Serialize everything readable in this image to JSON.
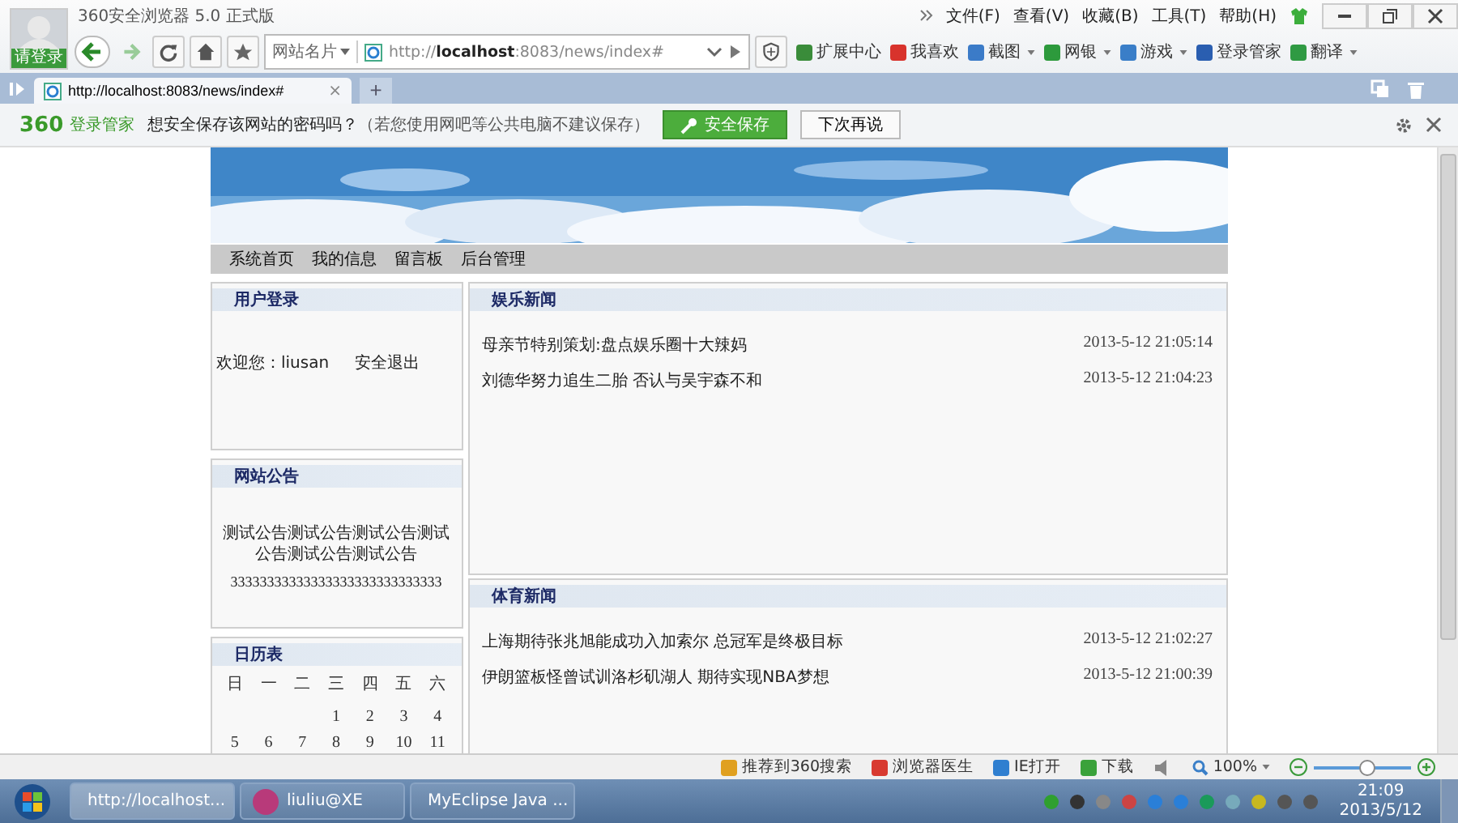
{
  "browser": {
    "title": "360安全浏览器 5.0 正式版",
    "avatar_label": "请登录",
    "menu": [
      "文件(F)",
      "查看(V)",
      "收藏(B)",
      "工具(T)",
      "帮助(H)"
    ],
    "site_card": "网站名片",
    "url": "http://**localhost**:8083/news/index#",
    "toolbar": [
      {
        "label": "扩展中心",
        "dropdown": false
      },
      {
        "label": "我喜欢",
        "dropdown": false
      },
      {
        "label": "截图",
        "dropdown": true
      },
      {
        "label": "网银",
        "dropdown": true
      },
      {
        "label": "游戏",
        "dropdown": true
      },
      {
        "label": "登录管家",
        "dropdown": false
      },
      {
        "label": "翻译",
        "dropdown": true
      }
    ],
    "tabs": [
      {
        "label": "http://localhost:8083/news/index#",
        "selected": true,
        "close": "×"
      }
    ],
    "new_tab": "+"
  },
  "password_bar": {
    "logo": "360",
    "product": "登录管家",
    "message": "想安全保存该网站的密码吗？",
    "hint": "（若您使用网吧等公共电脑不建议保存）",
    "save": "安全保存",
    "later": "下次再说"
  },
  "page": {
    "banner": {
      "kind": "picture"
    },
    "nav": [
      "系统首页",
      "我的信息",
      "留言板",
      "后台管理"
    ],
    "login": {
      "title": "用户登录",
      "welcome": "欢迎您：liusan",
      "logout": "安全退出"
    },
    "notice": {
      "title": "网站公告",
      "text": "测试公告测试公告测试公告测试公告测试公告测试公告",
      "extra": "33333333333333333333333333333"
    },
    "calendar": {
      "title": "日历表",
      "weekdays": [
        "日",
        "一",
        "二",
        "三",
        "四",
        "五",
        "六"
      ],
      "weeks": [
        [
          "1",
          "2",
          "3",
          "4"
        ],
        [
          "5",
          "6",
          "7",
          "8",
          "9",
          "10",
          "11"
        ]
      ]
    },
    "news_sections": [
      {
        "title": "娱乐新闻",
        "items": [
          {
            "headline": "母亲节特别策划:盘点娱乐圈十大辣妈",
            "time": "2013-5-12 21:05:14"
          },
          {
            "headline": "刘德华努力追生二胎 否认与吴宇森不和",
            "time": "2013-5-12 21:04:23"
          }
        ]
      },
      {
        "title": "体育新闻",
        "items": [
          {
            "headline": "上海期待张兆旭能成功入加索尔 总冠军是终极目标",
            "time": "2013-5-12 21:02:27"
          },
          {
            "headline": "伊朗篮板怪曾试训洛杉矶湖人 期待实现NBA梦想",
            "time": "2013-5-12 21:00:39"
          }
        ]
      }
    ]
  },
  "status_bar": {
    "items": [
      "推荐到360搜索",
      "浏览器医生",
      "IE打开",
      "下载"
    ],
    "zoom": "100%",
    "zoom_slider": {
      "level": 0.55
    }
  },
  "taskbar": {
    "tasks": [
      {
        "label": "http://localhost...",
        "selected": true
      },
      {
        "label": "liuliu@XE",
        "selected": false
      },
      {
        "label": "MyEclipse Java ...",
        "selected": false
      }
    ],
    "time": "21:09",
    "date": "2013/5/12"
  }
}
